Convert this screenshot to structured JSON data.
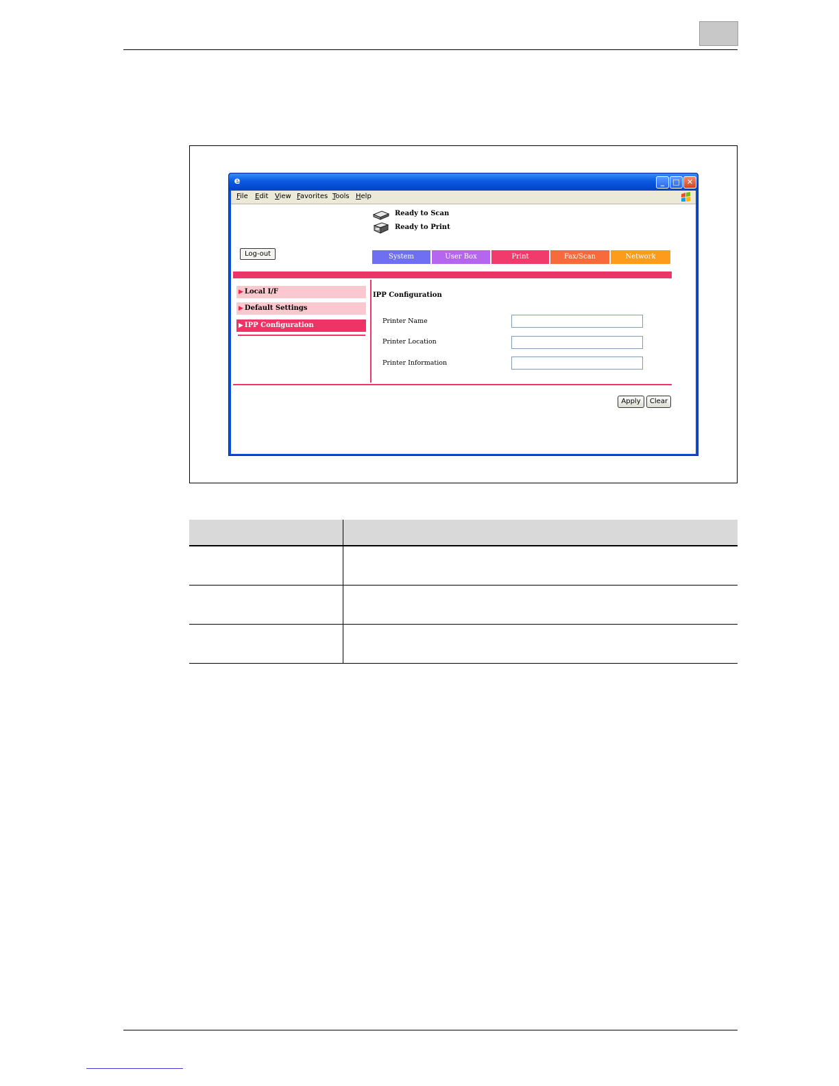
{
  "browser": {
    "menu": [
      "File",
      "Edit",
      "View",
      "Favorites",
      "Tools",
      "Help"
    ],
    "window_buttons": {
      "minimize": "_",
      "maximize": "□",
      "close": "✕"
    }
  },
  "status": [
    {
      "icon": "scanner-icon",
      "text": "Ready to Scan"
    },
    {
      "icon": "printer-icon",
      "text": "Ready to Print"
    }
  ],
  "logout_label": "Log-out",
  "tabs": [
    {
      "label": "System",
      "color": "#6f6ff4"
    },
    {
      "label": "User Box",
      "color": "#b566ee"
    },
    {
      "label": "Print",
      "color": "#f03b6c"
    },
    {
      "label": "Fax/Scan",
      "color": "#f66a3c"
    },
    {
      "label": "Network",
      "color": "#fb9c1c"
    }
  ],
  "sidebar": [
    {
      "label": "Local I/F",
      "active": false
    },
    {
      "label": "Default Settings",
      "active": false
    },
    {
      "label": "IPP Configuration",
      "active": true
    }
  ],
  "section_title": "IPP Configuration",
  "fields": [
    {
      "label": "Printer Name",
      "value": ""
    },
    {
      "label": "Printer Location",
      "value": ""
    },
    {
      "label": "Printer Information",
      "value": ""
    }
  ],
  "actions": {
    "apply": "Apply",
    "clear": "Clear"
  },
  "colors": {
    "accent": "#ee3366",
    "sidebar_inactive": "#fcc8cf"
  }
}
